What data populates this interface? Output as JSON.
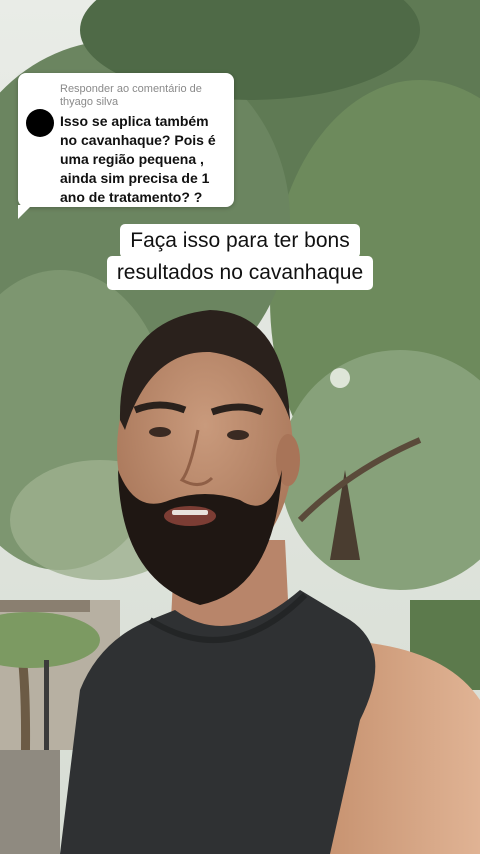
{
  "reply_card": {
    "header": "Responder ao comentário de thyago silva",
    "comment": "Isso se aplica também no cavanhaque? Pois é uma região pequena , ainda sim precisa de 1 ano de tratamento? ?"
  },
  "caption": {
    "line1": "Faça isso para ter bons",
    "line2": "resultados no cavanhaque"
  },
  "colors": {
    "caption_bg": "#ffffff",
    "shirt": "#2f3133",
    "beard": "#1f1713"
  }
}
